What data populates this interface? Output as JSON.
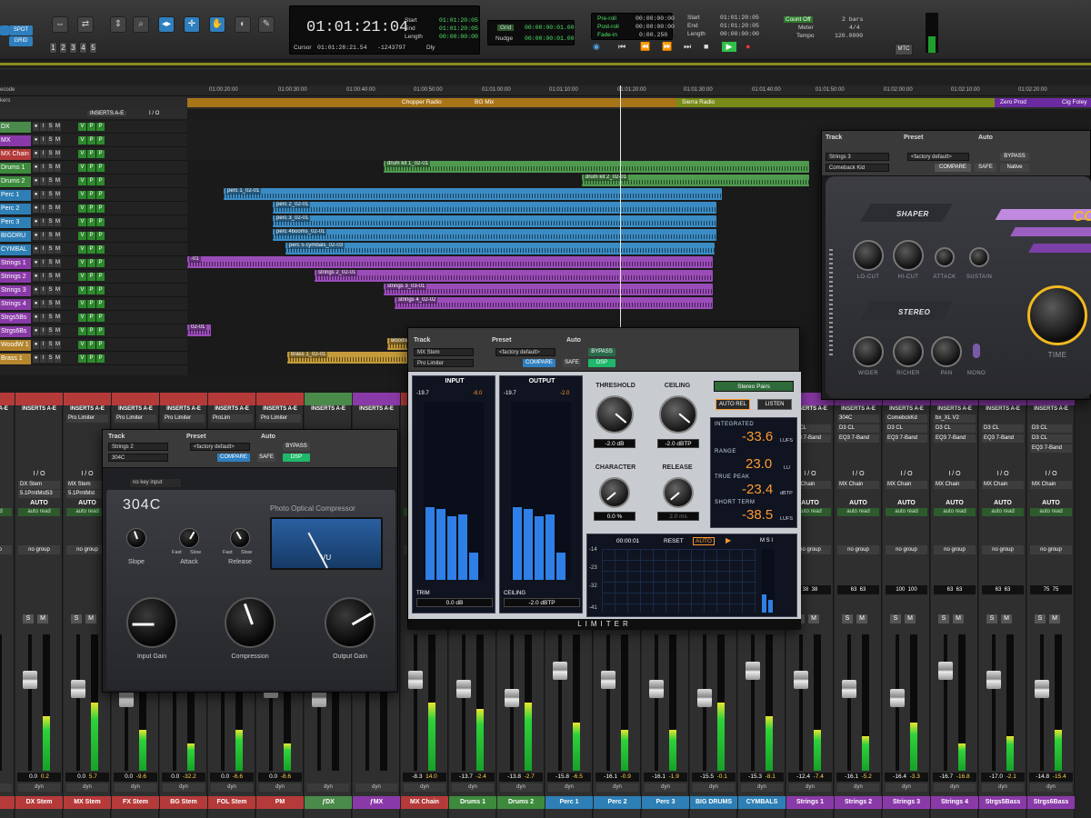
{
  "transport": {
    "edit_modes": [
      "SHUFFLE",
      "SPOT",
      "SLIP",
      "GRID"
    ],
    "zoom_presets": [
      "1",
      "2",
      "3",
      "4",
      "5"
    ],
    "main_counter": "01:01:21:04",
    "start_label": "Start",
    "start_value": "01:01:20:05",
    "end_label": "End",
    "end_value": "01:01:20:05",
    "length_label": "Length",
    "length_value": "00:00:00:00",
    "cursor_label": "Cursor",
    "cursor_value": "01:01:28:21.54",
    "cursor_samples": "-1243797",
    "dly_label": "Dly",
    "grid_label": "Grid",
    "grid_value": "00:00:00:01.00",
    "nudge_label": "Nudge",
    "nudge_value": "00:00:00:01.00",
    "preroll_label": "Pre-roll",
    "preroll_value": "00:00:00:00",
    "postroll_label": "Post-roll",
    "postroll_value": "00:00:00:00",
    "fadein_label": "Fade-in",
    "fadein_value": "0:00.250",
    "t_start_label": "Start",
    "t_start_value": "01:01:20:05",
    "t_end_label": "End",
    "t_end_value": "01:01:20:05",
    "t_length_label": "Length",
    "t_length_value": "00:00:00:00",
    "countoff_label": "Count Off",
    "countoff_value": "2 bars",
    "meter_label": "Meter",
    "meter_value": "4/4",
    "tempo_label": "Tempo",
    "tempo_value": "120.0000",
    "mtc_label": "MTC"
  },
  "timeline": {
    "timecode_label": "ecode",
    "markers_label": "kers",
    "ticks": [
      "01:00:20:00",
      "01:00:30:00",
      "01:00:40:00",
      "01:00:50:00",
      "01:01:00:00",
      "01:01:10:00",
      "01:01:20:00",
      "01:01:30:00",
      "01:01:40:00",
      "01:01:50:00",
      "01:02:00:00",
      "01:02:10:00",
      "01:02:20:00"
    ],
    "markers": [
      {
        "label": "Chopper Radio",
        "color": "#c58a1e"
      },
      {
        "label": "BG Mix",
        "color": "#c58a1e"
      },
      {
        "label": "Sierra Radio",
        "color": "#8a9a1e"
      },
      {
        "label": "Zero Prod",
        "color": "#7b2fb5"
      },
      {
        "label": "Cig Foley",
        "color": "#7b2fb5"
      }
    ],
    "header_inserts": "INSERTS A-E",
    "header_io": "I / O"
  },
  "tracks": [
    {
      "name": "DX",
      "color": "#4a8a4a"
    },
    {
      "name": "MX",
      "color": "#8a3aa8"
    },
    {
      "name": "MX Chain",
      "color": "#b53a3a",
      "vol": "-8.3"
    },
    {
      "name": "Drums 1",
      "color": "#3d8a3d"
    },
    {
      "name": "Drums 2",
      "color": "#3d8a3d"
    },
    {
      "name": "Perc 1",
      "color": "#2e7fb5"
    },
    {
      "name": "Perc 2",
      "color": "#2e7fb5"
    },
    {
      "name": "Perc 3",
      "color": "#2e7fb5"
    },
    {
      "name": "BIGDRU",
      "color": "#2e7fb5"
    },
    {
      "name": "CYMBAL",
      "color": "#2e7fb5"
    },
    {
      "name": "Strings 1",
      "color": "#8a3aa8"
    },
    {
      "name": "Strings 2",
      "color": "#8a3aa8"
    },
    {
      "name": "Strings 3",
      "color": "#8a3aa8"
    },
    {
      "name": "Strings 4",
      "color": "#8a3aa8"
    },
    {
      "name": "Strgs5Bs",
      "color": "#8a3aa8"
    },
    {
      "name": "Strgs6Bs",
      "color": "#8a3aa8"
    },
    {
      "name": "WoodW 1",
      "color": "#b5862e"
    },
    {
      "name": "Brass 1",
      "color": "#b5862e"
    }
  ],
  "clips": [
    {
      "name": "drum kit 1_02-01",
      "lane": 3,
      "color": "#4f9a4f"
    },
    {
      "name": "drum kit 2_02-01",
      "lane": 4,
      "color": "#4f9a4f"
    },
    {
      "name": "perc 1_02-01",
      "lane": 5,
      "color": "#3b8cc4"
    },
    {
      "name": "perc 2_02-01",
      "lane": 6,
      "color": "#3b8cc4"
    },
    {
      "name": "perc 3_02-01",
      "lane": 7,
      "color": "#3b8cc4"
    },
    {
      "name": "perc 4booms_02-01",
      "lane": 8,
      "color": "#3b8cc4"
    },
    {
      "name": "perc 5 cymbals_02-03",
      "lane": 9,
      "color": "#3b8cc4"
    },
    {
      "name": "-01",
      "lane": 10,
      "color": "#9a4cb8"
    },
    {
      "name": "strings 2_02-01",
      "lane": 11,
      "color": "#9a4cb8"
    },
    {
      "name": "strings 3_03-01",
      "lane": 12,
      "color": "#9a4cb8"
    },
    {
      "name": "strings 4_02-02",
      "lane": 13,
      "color": "#9a4cb8"
    },
    {
      "name": "02-01",
      "lane": 15,
      "color": "#9a4cb8"
    },
    {
      "name": "woodw",
      "lane": 16,
      "color": "#c49a3a"
    },
    {
      "name": "brass 1_02-01",
      "lane": 17,
      "color": "#c49a3a"
    }
  ],
  "mixer": {
    "inserts_header": "INSERTS A-E",
    "io_header": "I / O",
    "auto_header": "AUTO",
    "auto_value": "auto read",
    "group_value": "no group",
    "dyn_label": "dyn",
    "strips": [
      {
        "name": "",
        "color": "#b53a3a",
        "insert": "",
        "vol": "",
        "peak": "",
        "out": "",
        "pan": ""
      },
      {
        "name": "DX Stem",
        "color": "#b53a3a",
        "insert": "",
        "io1": "DX Stem",
        "io2": "5.1PrntMst53",
        "vol": "0.0",
        "peak": "0.2",
        "pan": "",
        "meter": 0.4
      },
      {
        "name": "MX Stem",
        "color": "#b53a3a",
        "insert": "Pro Limiter",
        "io1": "MX Stem",
        "io2": "5.1PrntMst",
        "vol": "0.0",
        "peak": "5.7",
        "pan": "",
        "meter": 0.5
      },
      {
        "name": "FX Stem",
        "color": "#b53a3a",
        "insert": "Pro Limiter",
        "io1": "",
        "io2": "",
        "vol": "0.0",
        "peak": "-9.6",
        "pan": "",
        "meter": 0.3
      },
      {
        "name": "BG Stem",
        "color": "#b53a3a",
        "insert": "Pro Limiter",
        "io1": "",
        "io2": "",
        "vol": "0.0",
        "peak": "-32.2",
        "pan": "",
        "meter": 0.2
      },
      {
        "name": "FOL Stem",
        "color": "#b53a3a",
        "insert": "ProLim",
        "io1": "",
        "io2": "",
        "vol": "0.0",
        "peak": "-6.6",
        "pan": "",
        "meter": 0.3
      },
      {
        "name": "PM",
        "color": "#b53a3a",
        "insert": "Pro Limiter",
        "io1": "",
        "io2": "",
        "vol": "0.0",
        "peak": "-8.6",
        "pan": "",
        "meter": 0.2
      },
      {
        "name": "ƒDX",
        "color": "#4a8a4a",
        "insert": "",
        "vol": "",
        "peak": "",
        "pan": "",
        "meter": 0
      },
      {
        "name": "ƒMX",
        "color": "#8a3aa8",
        "insert": "",
        "vol": "",
        "peak": "",
        "pan": "",
        "meter": 0
      },
      {
        "name": "MX Chain",
        "color": "#b53a3a",
        "insert": "",
        "vol": "-8.3",
        "peak": "14.0",
        "pan": "",
        "meter": 0.5
      },
      {
        "name": "Drums 1",
        "color": "#3d8a3d",
        "insert": "",
        "vol": "-13.7",
        "peak": "-2.4",
        "pan": "",
        "meter": 0.45
      },
      {
        "name": "Drums 2",
        "color": "#3d8a3d",
        "insert": "",
        "vol": "-13.8",
        "peak": "-2.7",
        "pan": "",
        "meter": 0.5
      },
      {
        "name": "Perc 1",
        "color": "#2e7fb5",
        "insert": "",
        "vol": "-15.8",
        "peak": "-6.5",
        "pan": "",
        "meter": 0.35
      },
      {
        "name": "Perc 2",
        "color": "#2e7fb5",
        "insert": "",
        "vol": "-16.1",
        "peak": "-0.9",
        "pan": "",
        "meter": 0.3
      },
      {
        "name": "Perc 3",
        "color": "#2e7fb5",
        "insert": "",
        "vol": "-16.1",
        "peak": "-1.9",
        "pan": "",
        "meter": 0.3
      },
      {
        "name": "BIG DRUMS",
        "color": "#2e7fb5",
        "insert": "",
        "vol": "-15.5",
        "peak": "-0.1",
        "pan": "",
        "meter": 0.5
      },
      {
        "name": "CYMBALS",
        "color": "#2e7fb5",
        "insert": "",
        "vol": "-15.3",
        "peak": "-8.1",
        "pan": "",
        "meter": 0.4
      },
      {
        "name": "Strings 1",
        "color": "#8a3aa8",
        "insert": "",
        "ins2": "D3 CL",
        "ins3": "EQ3 7-Band",
        "io1": "MX Chain",
        "vol": "-12.4",
        "peak": "-7.4",
        "pan": "38",
        "pan2": "38",
        "meter": 0.3
      },
      {
        "name": "Strings 2",
        "color": "#8a3aa8",
        "insert": "304C",
        "ins2": "D3 CL",
        "ins3": "EQ3 7-Band",
        "io1": "MX Chain",
        "vol": "-16.1",
        "peak": "-5.2",
        "pan": "63",
        "pan2": "63",
        "meter": 0.25
      },
      {
        "name": "Strings 3",
        "color": "#8a3aa8",
        "insert": "ComebckKd",
        "ins2": "D3 CL",
        "ins3": "EQ3 7-Band",
        "io1": "MX Chain",
        "vol": "-16.4",
        "peak": "-3.3",
        "pan": "100",
        "pan2": "100",
        "meter": 0.35
      },
      {
        "name": "Strings 4",
        "color": "#8a3aa8",
        "insert": "bx_XL V2",
        "ins2": "D3 CL",
        "ins3": "EQ3 7-Band",
        "io1": "MX Chain",
        "vol": "-16.7",
        "peak": "-16.8",
        "pan": "63",
        "pan2": "63",
        "meter": 0.2
      },
      {
        "name": "Strgs5Bass",
        "color": "#8a3aa8",
        "insert": "",
        "ins2": "D3 CL",
        "ins3": "EQ3 7-Band",
        "io1": "MX Chain",
        "vol": "-17.0",
        "peak": "-2.1",
        "pan": "63",
        "pan2": "63",
        "meter": 0.25
      },
      {
        "name": "Strgs6Bass",
        "color": "#8a3aa8",
        "insert": "",
        "ins2": "D3 CL",
        "ins3": "D3 DE",
        "ins4": "D3 CL",
        "ins5": "EQ3 7-Band",
        "io1": "MX Chain",
        "vol": "-14.8",
        "peak": "-15.4",
        "pan": "75",
        "pan2": "75",
        "meter": 0.3
      }
    ]
  },
  "limiter": {
    "track_label": "Track",
    "track_value": "MX Stem",
    "preset_label": "Preset",
    "preset_value": "<factory default>",
    "auto_label": "Auto",
    "plugin_name": "Pro Limiter",
    "compare": "COMPARE",
    "bypass": "BYPASS",
    "safe": "SAFE",
    "dsp": "DSP",
    "input_label": "INPUT",
    "output_label": "OUTPUT",
    "input_peak": "-19.7",
    "input_peak2": "-8.0",
    "output_peak": "-19.7",
    "output_peak2": "-2.0",
    "trim_label": "TRIM",
    "trim_value": "0.0 dB",
    "ceiling_label": "CEILING",
    "ceiling_value": "-2.0 dBTP",
    "threshold_label": "THRESHOLD",
    "threshold_value": "-2.0 dB",
    "ceil_label2": "CEILING",
    "ceil_value2": "-2.0 dBTP",
    "character_label": "CHARACTER",
    "character_value": "0.0 %",
    "release_label": "RELEASE",
    "release_value": "2.0 ms",
    "stereo_mode": "Stereo Pairs",
    "auto_rel": "AUTO REL",
    "listen": "LISTEN",
    "integrated_label": "INTEGRATED",
    "integrated_value": "-33.6",
    "integrated_unit": "LUFS",
    "range_label": "RANGE",
    "range_value": "23.0",
    "range_unit": "LU",
    "truepeak_label": "TRUE PEAK",
    "truepeak_value": "-23.4",
    "truepeak_unit": "dBTP",
    "shortterm_label": "SHORT TERM",
    "shortterm_value": "-38.5",
    "shortterm_unit": "LUFS",
    "history_time": "00:00:01",
    "reset": "RESET",
    "auto": "AUTO",
    "history_scale": [
      "-14",
      "-23",
      "-32",
      "-41"
    ],
    "history_scale_r": [
      "-14",
      "-18",
      "-23",
      "-27",
      "-32",
      "-36",
      "-41"
    ],
    "msi": "M S I",
    "title": "LIMITER"
  },
  "comp304": {
    "track_label": "Track",
    "track_value": "Strings 2",
    "preset_label": "Preset",
    "preset_value": "<factory default>",
    "auto_label": "Auto",
    "plugin_name": "304C",
    "compare": "COMPARE",
    "bypass": "BYPASS",
    "safe": "SAFE",
    "dsp": "DSP",
    "sidechain": "no key input",
    "logo": "304C",
    "subtitle": "Photo Optical Compressor",
    "slope_label": "Slope",
    "attack_label": "Attack",
    "release_label": "Release",
    "fast_label": "Fast",
    "slow_label": "Slow",
    "vu_label": "VU",
    "input_gain_label": "Input Gain",
    "compression_label": "Compression",
    "output_gain_label": "Output Gain"
  },
  "ckid": {
    "track_label": "Track",
    "track_value": "Strings 3",
    "preset_label": "Preset",
    "preset_value": "<factory default>",
    "auto_label": "Auto",
    "plugin_name": "Comeback Kid",
    "compare": "COMPARE",
    "bypass": "BYPASS",
    "safe": "SAFE",
    "native": "Native",
    "shaper_label": "SHAPER",
    "stereo_label": "STEREO",
    "brand": "CO",
    "lo_cut": "LO-CUT",
    "hi_cut": "HI-CUT",
    "attack": "ATTACK",
    "sustain": "SUSTAIN",
    "wider": "WIDER",
    "richer": "RICHER",
    "pan": "PAN",
    "mono": "MONO",
    "time": "TIME"
  }
}
